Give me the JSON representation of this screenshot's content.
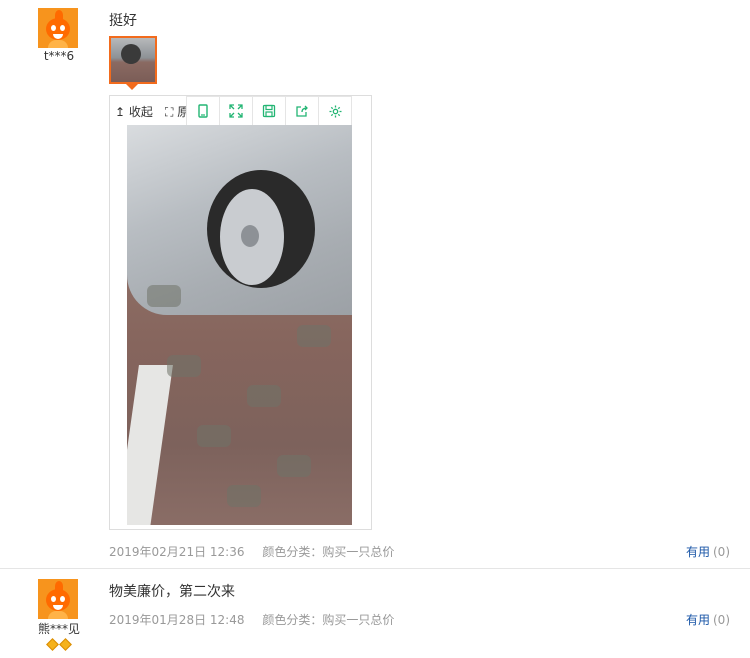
{
  "reviews": [
    {
      "username": "t***6",
      "text": "挺好",
      "date": "2019年02月21日 12:36",
      "color_category": "颜色分类：购买一只总价",
      "useful_label": "有用",
      "useful_count": "(0)",
      "has_image": true
    },
    {
      "username": "熊***见",
      "text": "物美廉价，第二次来",
      "date": "2019年01月28日 12:48",
      "color_category": "颜色分类：购买一只总价",
      "useful_label": "有用",
      "useful_count": "(0)",
      "badges": [
        "diamond",
        "diamond"
      ]
    }
  ],
  "viewer": {
    "collapse_label": "↥ 收起",
    "original_label": "⛶ 原图",
    "tools": [
      "phone-icon",
      "fullscreen-icon",
      "save-icon",
      "share-icon",
      "settings-icon"
    ]
  },
  "colors": {
    "accent": "#f26b1d",
    "link": "#1a56a7",
    "tool_icon": "#22b573"
  }
}
